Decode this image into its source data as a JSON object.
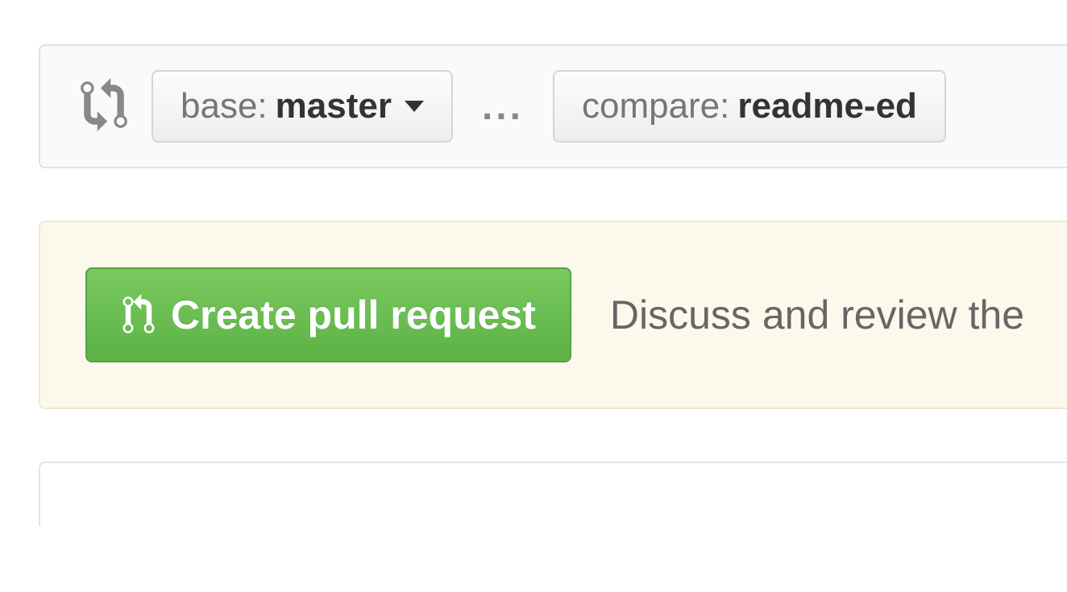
{
  "compare": {
    "base_prefix": "base:",
    "base_value": "master",
    "separator": "...",
    "compare_prefix": "compare:",
    "compare_value": "readme-ed"
  },
  "banner": {
    "button_label": "Create pull request",
    "description": "Discuss and review the"
  }
}
